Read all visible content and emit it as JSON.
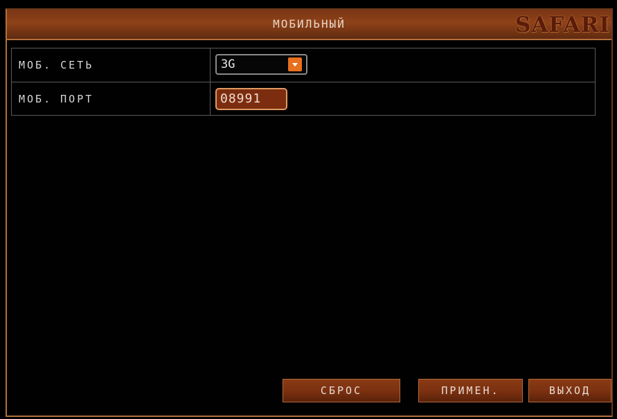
{
  "window": {
    "title": "МОБИЛЬНЫЙ",
    "brand_logo": "SAFARI"
  },
  "settings": {
    "network": {
      "label": "МОБ. СЕТЬ",
      "value": "3G",
      "control": "dropdown",
      "arrow_icon": "chevron-down-icon"
    },
    "port": {
      "label": "МОБ. ПОРТ",
      "value": "08991"
    }
  },
  "buttons": {
    "reset": "СБРОС",
    "apply": "ПРИМЕН.",
    "exit": "ВЫХОД"
  },
  "colors": {
    "accent": "#e8701e",
    "titlebar": "#8e4218",
    "button": "#7a3010",
    "input_focus_bg": "#7c2d0f"
  }
}
